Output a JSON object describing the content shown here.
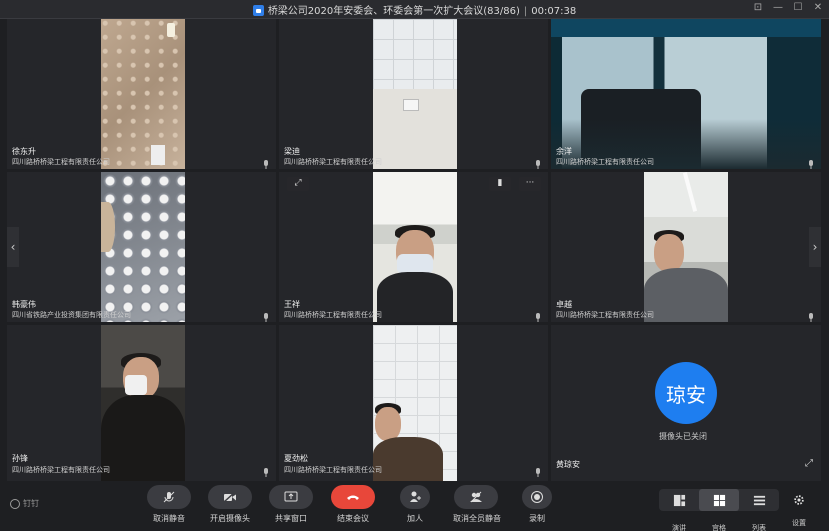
{
  "window": {
    "title": "桥梁公司2020年安委会、环委会第一次扩大会议(83/86)",
    "timer": "00:07:38",
    "controls": [
      "⊡",
      "—",
      "☐",
      "✕"
    ]
  },
  "tiles": [
    {
      "name": "徐东升",
      "org": "四川路桥桥梁工程有限责任公司"
    },
    {
      "name": "梁迪",
      "org": "四川路桥桥梁工程有限责任公司"
    },
    {
      "name": "余洋",
      "org": "四川路桥桥梁工程有限责任公司"
    },
    {
      "name": "韩豪伟",
      "org": "四川省铁路产业投资集团有限责任公司"
    },
    {
      "name": "王祥",
      "org": "四川路桥桥梁工程有限责任公司"
    },
    {
      "name": "卓越",
      "org": "四川路桥桥梁工程有限责任公司"
    },
    {
      "name": "孙锋",
      "org": "四川路桥桥梁工程有限责任公司"
    },
    {
      "name": "夏劲松",
      "org": "四川路桥桥梁工程有限责任公司"
    },
    {
      "name": "黄琼安",
      "org": "",
      "avatar_text": "琼安",
      "camera_status": "摄像头已关闭"
    }
  ],
  "nav": {
    "prev": "‹",
    "next": "›"
  },
  "toolbar": {
    "logo_text": "钉钉",
    "items": [
      {
        "label": "取消静音"
      },
      {
        "label": "开启摄像头"
      },
      {
        "label": "共享窗口"
      },
      {
        "label": "结束会议"
      },
      {
        "label": "加人"
      },
      {
        "label": "取消全员静音"
      },
      {
        "label": "录制"
      }
    ],
    "layouts": [
      {
        "label": "演讲"
      },
      {
        "label": "宫格"
      },
      {
        "label": "列表"
      }
    ],
    "settings_label": "设置"
  },
  "colors": {
    "accent": "#1e7ef0",
    "end_call": "#e8473a",
    "background": "#1e1f22"
  }
}
